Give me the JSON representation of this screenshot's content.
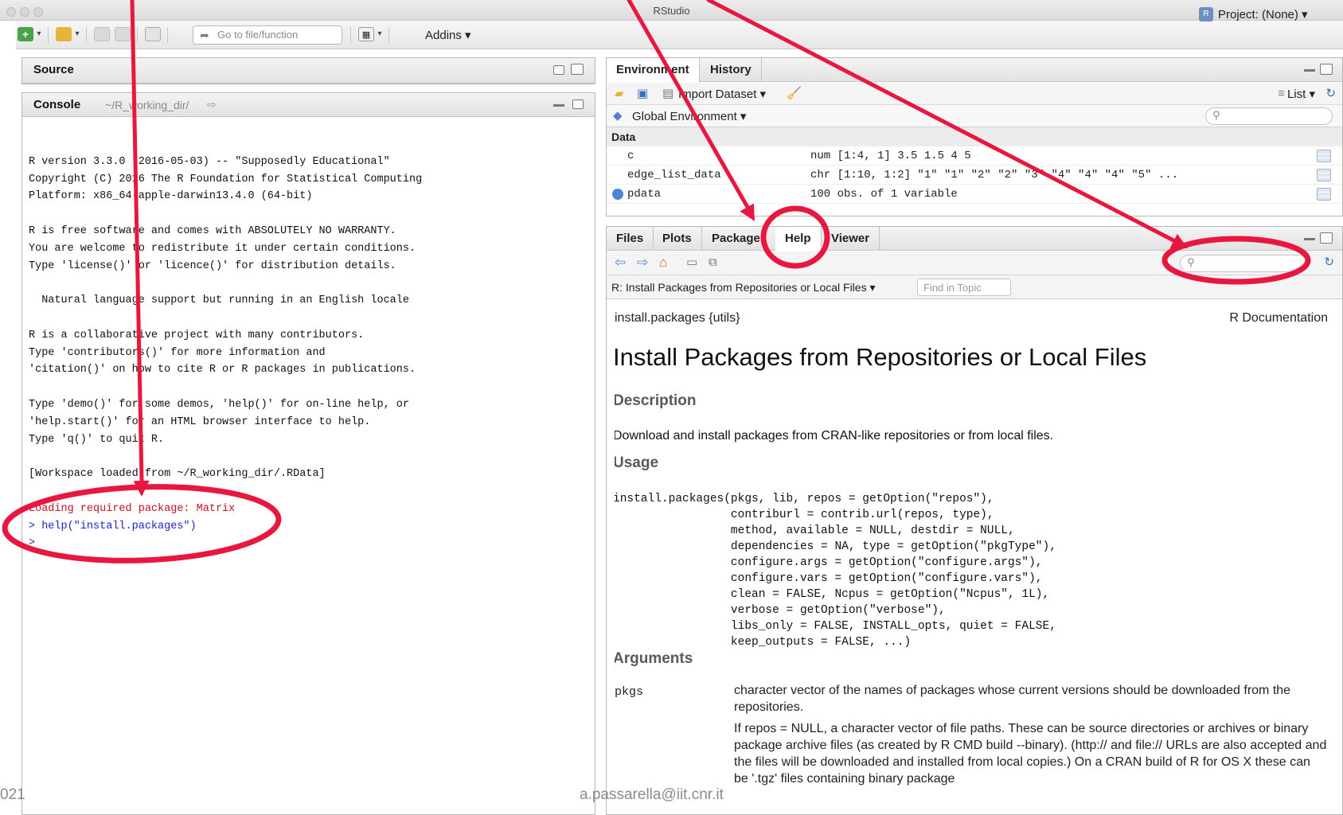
{
  "window": {
    "title": "RStudio"
  },
  "toolbar": {
    "goto_placeholder": "Go to file/function",
    "addins_label": "Addins ▾",
    "project_label": "Project: (None) ▾"
  },
  "source": {
    "title": "Source"
  },
  "console": {
    "title": "Console",
    "path": "~/R_working_dir/",
    "lines": [
      {
        "text": "",
        "kind": "normal"
      },
      {
        "text": "R version 3.3.0 (2016-05-03) -- \"Supposedly Educational\"",
        "kind": "normal"
      },
      {
        "text": "Copyright (C) 2016 The R Foundation for Statistical Computing",
        "kind": "normal"
      },
      {
        "text": "Platform: x86_64-apple-darwin13.4.0 (64-bit)",
        "kind": "normal"
      },
      {
        "text": "",
        "kind": "normal"
      },
      {
        "text": "R is free software and comes with ABSOLUTELY NO WARRANTY.",
        "kind": "normal"
      },
      {
        "text": "You are welcome to redistribute it under certain conditions.",
        "kind": "normal"
      },
      {
        "text": "Type 'license()' or 'licence()' for distribution details.",
        "kind": "normal"
      },
      {
        "text": "",
        "kind": "normal"
      },
      {
        "text": "  Natural language support but running in an English locale",
        "kind": "normal"
      },
      {
        "text": "",
        "kind": "normal"
      },
      {
        "text": "R is a collaborative project with many contributors.",
        "kind": "normal"
      },
      {
        "text": "Type 'contributors()' for more information and",
        "kind": "normal"
      },
      {
        "text": "'citation()' on how to cite R or R packages in publications.",
        "kind": "normal"
      },
      {
        "text": "",
        "kind": "normal"
      },
      {
        "text": "Type 'demo()' for some demos, 'help()' for on-line help, or",
        "kind": "normal"
      },
      {
        "text": "'help.start()' for an HTML browser interface to help.",
        "kind": "normal"
      },
      {
        "text": "Type 'q()' to quit R.",
        "kind": "normal"
      },
      {
        "text": "",
        "kind": "normal"
      },
      {
        "text": "[Workspace loaded from ~/R_working_dir/.RData]",
        "kind": "normal"
      },
      {
        "text": "",
        "kind": "normal"
      },
      {
        "text": "Loading required package: Matrix",
        "kind": "red"
      },
      {
        "text": "> help(\"install.packages\")",
        "kind": "blue"
      },
      {
        "text": ">",
        "kind": "blue"
      }
    ]
  },
  "environment": {
    "tabs": [
      "Environment",
      "History"
    ],
    "import_label": "Import Dataset ▾",
    "list_label": "List ▾",
    "global_env_label": "Global Environment ▾",
    "section_label": "Data",
    "rows": [
      {
        "name": "c",
        "value": "num [1:4, 1] 3.5 1.5 4 5"
      },
      {
        "name": "edge_list_data",
        "value": "chr [1:10, 1:2] \"1\" \"1\" \"2\" \"2\" \"3\" \"4\" \"4\" \"4\" \"5\" ..."
      },
      {
        "name": "pdata",
        "value": "100 obs. of 1 variable"
      }
    ]
  },
  "help": {
    "tabs": [
      "Files",
      "Plots",
      "Packages",
      "Help",
      "Viewer"
    ],
    "topic_title": "R: Install Packages from Repositories or Local Files ▾",
    "find_placeholder": "Find in Topic",
    "doc": {
      "package": "install.packages {utils}",
      "rdoc": "R Documentation",
      "title": "Install Packages from Repositories or Local Files",
      "description_heading": "Description",
      "description_text": "Download and install packages from CRAN-like repositories or from local files.",
      "usage_heading": "Usage",
      "usage_code": "install.packages(pkgs, lib, repos = getOption(\"repos\"),\n                 contriburl = contrib.url(repos, type),\n                 method, available = NULL, destdir = NULL,\n                 dependencies = NA, type = getOption(\"pkgType\"),\n                 configure.args = getOption(\"configure.args\"),\n                 configure.vars = getOption(\"configure.vars\"),\n                 clean = FALSE, Ncpus = getOption(\"Ncpus\", 1L),\n                 verbose = getOption(\"verbose\"),\n                 libs_only = FALSE, INSTALL_opts, quiet = FALSE,\n                 keep_outputs = FALSE, ...)",
      "arguments_heading": "Arguments",
      "arg_name": "pkgs",
      "arg_desc1": "character vector of the names of packages whose current versions should be downloaded from the repositories.",
      "arg_desc2": "If repos = NULL, a character vector of file paths. These can be source directories or archives or binary package archive files (as created by R CMD build --binary). (http:// and file:// URLs are also accepted and the files will be downloaded and installed from local copies.) On a CRAN build of R for OS X these can be '.tgz' files containing binary package"
    }
  },
  "footer": {
    "left": "021",
    "center": "a.passarella@iit.cnr.it"
  },
  "colors": {
    "annotation": "#e8173f",
    "console_red": "#c4121e",
    "console_blue": "#1e23c8"
  }
}
